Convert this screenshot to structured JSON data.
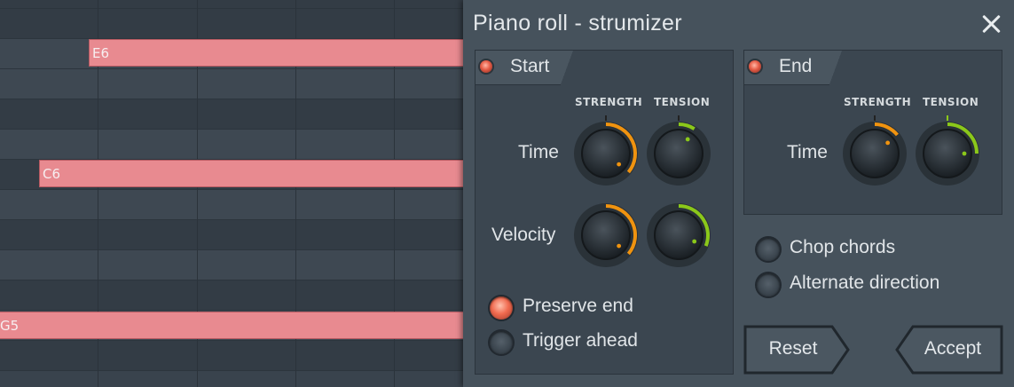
{
  "piano_roll": {
    "notes": [
      {
        "label": "E6"
      },
      {
        "label": "C6"
      },
      {
        "label": "G5"
      }
    ]
  },
  "dialog": {
    "title": "Piano roll - strumizer",
    "start_panel": {
      "tab_label": "Start",
      "strength_label": "STRENGTH",
      "tension_label": "TENSION",
      "time_label": "Time",
      "velocity_label": "Velocity",
      "knobs": {
        "time_strength": 0.72,
        "time_tension": 0.18,
        "velocity_strength": 0.72,
        "velocity_tension": 0.62
      },
      "preserve_end_label": "Preserve end",
      "preserve_end_on": true,
      "trigger_ahead_label": "Trigger ahead",
      "trigger_ahead_on": false
    },
    "end_panel": {
      "tab_label": "End",
      "strength_label": "STRENGTH",
      "tension_label": "TENSION",
      "time_label": "Time",
      "knobs": {
        "time_strength": 0.28,
        "time_tension": 0.5
      }
    },
    "chop_chords_label": "Chop chords",
    "alternate_direction_label": "Alternate direction",
    "reset_label": "Reset",
    "accept_label": "Accept",
    "colors": {
      "strength_accent": "#f0930f",
      "tension_accent": "#8bc81a",
      "note_fill": "#e88a90"
    }
  }
}
